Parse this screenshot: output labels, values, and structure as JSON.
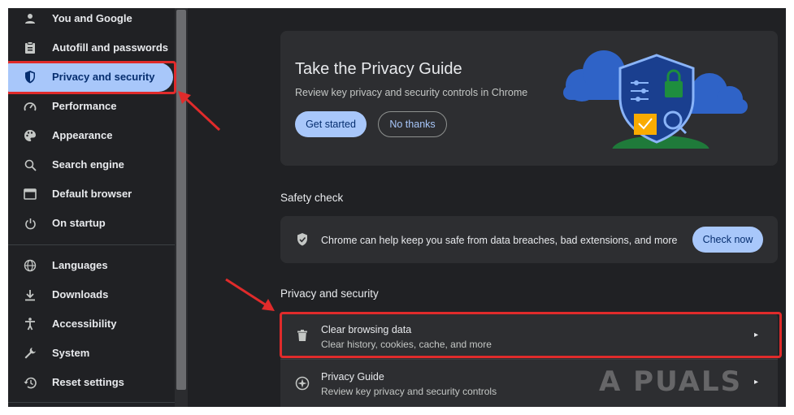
{
  "sidebar": {
    "items": [
      {
        "label": "You and Google",
        "icon": "person-icon"
      },
      {
        "label": "Autofill and passwords",
        "icon": "clipboard-icon"
      },
      {
        "label": "Privacy and security",
        "icon": "shield-icon",
        "active": true
      },
      {
        "label": "Performance",
        "icon": "speedometer-icon"
      },
      {
        "label": "Appearance",
        "icon": "palette-icon"
      },
      {
        "label": "Search engine",
        "icon": "search-icon"
      },
      {
        "label": "Default browser",
        "icon": "browser-window-icon"
      },
      {
        "label": "On startup",
        "icon": "power-icon"
      },
      {
        "label": "Languages",
        "icon": "globe-icon"
      },
      {
        "label": "Downloads",
        "icon": "download-icon"
      },
      {
        "label": "Accessibility",
        "icon": "accessibility-icon"
      },
      {
        "label": "System",
        "icon": "wrench-icon"
      },
      {
        "label": "Reset settings",
        "icon": "history-icon"
      }
    ]
  },
  "privacy_guide_card": {
    "title": "Take the Privacy Guide",
    "subtitle": "Review key privacy and security controls in Chrome",
    "get_started": "Get started",
    "no_thanks": "No thanks"
  },
  "safety_check": {
    "section_title": "Safety check",
    "text": "Chrome can help keep you safe from data breaches, bad extensions, and more",
    "button": "Check now"
  },
  "privacy_section": {
    "section_title": "Privacy and security",
    "rows": [
      {
        "title": "Clear browsing data",
        "subtitle": "Clear history, cookies, cache, and more",
        "icon": "trash-icon"
      },
      {
        "title": "Privacy Guide",
        "subtitle": "Review key privacy and security controls",
        "icon": "compass-icon"
      }
    ]
  },
  "watermark": "A  PUALS",
  "colors": {
    "background": "#202124",
    "card": "#2d2e31",
    "accent": "#a8c7fa",
    "highlight": "#e02b2b"
  }
}
